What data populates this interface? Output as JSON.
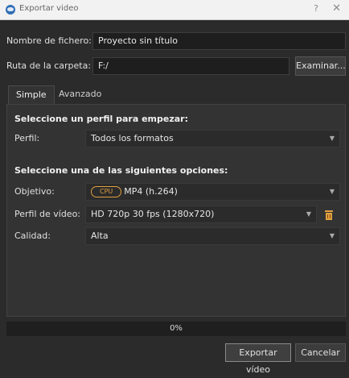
{
  "window": {
    "title": "Exportar video",
    "help_label": "?",
    "close_label": "✕"
  },
  "file": {
    "name_label": "Nombre de fichero:",
    "name_value": "Proyecto sin título",
    "folder_label": "Ruta de la carpeta:",
    "folder_value": "F:/",
    "browse_label": "Examinar..."
  },
  "tabs": [
    {
      "label": "Simple",
      "active": true
    },
    {
      "label": "Avanzado",
      "active": false
    }
  ],
  "simple": {
    "profile_section_title": "Seleccione un perfil para empezar:",
    "profile_label": "Perfil:",
    "profile_value": "Todos los formatos",
    "options_section_title": "Seleccione una de las siguientes opciones:",
    "target_label": "Objetivo:",
    "target_badge": "CPU",
    "target_value": "MP4 (h.264)",
    "video_profile_label": "Perfil de vídeo:",
    "video_profile_value": "HD 720p 30 fps (1280x720)",
    "quality_label": "Calidad:",
    "quality_value": "Alta"
  },
  "progress": {
    "text": "0%",
    "value": 0
  },
  "footer": {
    "export_label": "Exportar vídeo",
    "cancel_label": "Cancelar"
  },
  "colors": {
    "accent": "#e0a040",
    "background": "#2b2b2b",
    "titlebar": "#f2f2f2"
  },
  "icons": {
    "app": "app-logo-icon",
    "dropdown": "chevron-down-icon",
    "delete": "trash-icon"
  }
}
